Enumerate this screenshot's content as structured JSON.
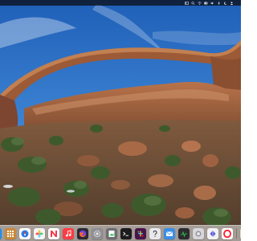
{
  "menubar": {
    "clock": "",
    "status_icons": [
      "control-center-icon",
      "spotlight-icon",
      "wifi-icon",
      "battery-icon",
      "volume-icon",
      "bluetooth-icon",
      "focus-icon",
      "user-icon"
    ]
  },
  "desktop": {
    "wallpaper": "landscape-arch-sandstone"
  },
  "dock": {
    "apps": [
      {
        "icon": "finder-icon",
        "color": "#1f8ef1"
      },
      {
        "icon": "launchpad-icon",
        "color": "#c98a3a"
      },
      {
        "icon": "safari-icon",
        "color": "#2a7be0"
      },
      {
        "icon": "photos-icon",
        "color": "#f5f5f5"
      },
      {
        "icon": "news-icon",
        "color": "#f23b4f"
      },
      {
        "icon": "music-icon",
        "color": "#fc3c44"
      },
      {
        "icon": "firefox-icon",
        "color": "#ff6a1a"
      },
      {
        "icon": "system-settings-icon",
        "color": "#8e8e93"
      },
      {
        "icon": "preview-icon",
        "color": "#6d6d72"
      },
      {
        "icon": "terminal-icon",
        "color": "#1c1c1e"
      },
      {
        "icon": "slack-icon",
        "color": "#4a154b"
      },
      {
        "icon": "help-icon",
        "color": "#e9e9ec"
      },
      {
        "icon": "mail-icon",
        "color": "#3a8ee6"
      },
      {
        "icon": "activity-monitor-icon",
        "color": "#2c2c2e"
      },
      {
        "icon": "mirror-icon",
        "color": "#d7d7db"
      },
      {
        "icon": "kite-icon",
        "color": "#f2f2f4"
      },
      {
        "icon": "opera-icon",
        "color": "#ff1b2d"
      },
      {
        "icon": "zen-icon",
        "color": "#e6dcc8"
      }
    ]
  }
}
